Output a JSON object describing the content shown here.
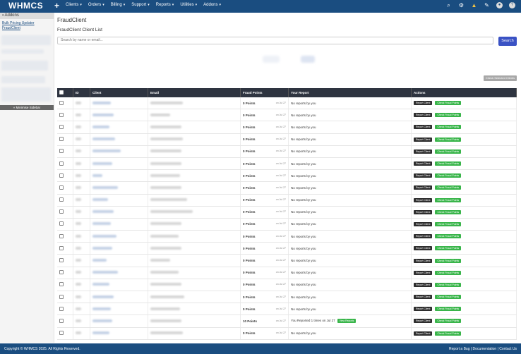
{
  "topnav": {
    "logo": "WHMCS",
    "plus": "+",
    "menu": [
      "Clients",
      "Orders",
      "Billing",
      "Support",
      "Reports",
      "Utilities",
      "Addons"
    ],
    "caret": "▾",
    "icons": [
      "search-icon",
      "gear-icon",
      "warning-icon",
      "wrench-icon",
      "user-avatar-icon",
      "help-icon"
    ]
  },
  "sidebar": {
    "panel_title": "Addons",
    "links": [
      "Bulk Pricing Updater",
      "FraudClient"
    ],
    "minimize": "« Minimise Sidebar"
  },
  "page": {
    "title": "FraudClient",
    "subtitle": "FraudClient Client List",
    "search_placeholder": "Search by name or email...",
    "search_button": "Search",
    "check_selected": "Check Selected Clients"
  },
  "table": {
    "headers": [
      "",
      "ID",
      "Client",
      "Email",
      "Fraud Points",
      "Your Report",
      "Actions"
    ],
    "rows": [
      {
        "points": "0 Points",
        "date": "on Jul 27",
        "report": "No reports by you"
      },
      {
        "points": "0 Points",
        "date": "on Jul 27",
        "report": "No reports by you"
      },
      {
        "points": "0 Points",
        "date": "on Jul 27",
        "report": "No reports by you"
      },
      {
        "points": "0 Points",
        "date": "on Jul 27",
        "report": "No reports by you"
      },
      {
        "points": "0 Points",
        "date": "on Jul 27",
        "report": "No reports by you"
      },
      {
        "points": "0 Points",
        "date": "on Jul 27",
        "report": "No reports by you"
      },
      {
        "points": "0 Points",
        "date": "on Jul 27",
        "report": "No reports by you"
      },
      {
        "points": "0 Points",
        "date": "on Jul 27",
        "report": "No reports by you"
      },
      {
        "points": "0 Points",
        "date": "on Jul 27",
        "report": "No reports by you"
      },
      {
        "points": "0 Points",
        "date": "on Jul 27",
        "report": "No reports by you"
      },
      {
        "points": "0 Points",
        "date": "on Jul 27",
        "report": "No reports by you"
      },
      {
        "points": "0 Points",
        "date": "on Jul 27",
        "report": "No reports by you"
      },
      {
        "points": "0 Points",
        "date": "on Jul 27",
        "report": "No reports by you"
      },
      {
        "points": "0 Points",
        "date": "on Jul 27",
        "report": "No reports by you"
      },
      {
        "points": "0 Points",
        "date": "on Jul 27",
        "report": "No reports by you"
      },
      {
        "points": "0 Points",
        "date": "on Jul 27",
        "report": "No reports by you"
      },
      {
        "points": "0 Points",
        "date": "on Jul 27",
        "report": "No reports by you"
      },
      {
        "points": "0 Points",
        "date": "on Jul 27",
        "report": "No reports by you"
      },
      {
        "points": "10 Points",
        "date": "on Jul 27",
        "report": "You Reported 1 times on Jul 27",
        "view": "View Reports"
      },
      {
        "points": "0 Points",
        "date": "on Jul 27",
        "report": "No reports by you"
      }
    ],
    "report_button": "Report Client",
    "check_button": "Check Fraud Points"
  },
  "footer": {
    "copyright": "Copyright © WHMCS 2025. All Rights Reserved.",
    "links": "Report a Bug | Documentation | Contact Us"
  },
  "colors": {
    "nav": "#1a4d80",
    "table_head": "#2e3440",
    "green": "#39b54a",
    "search_btn": "#3a52c4"
  }
}
